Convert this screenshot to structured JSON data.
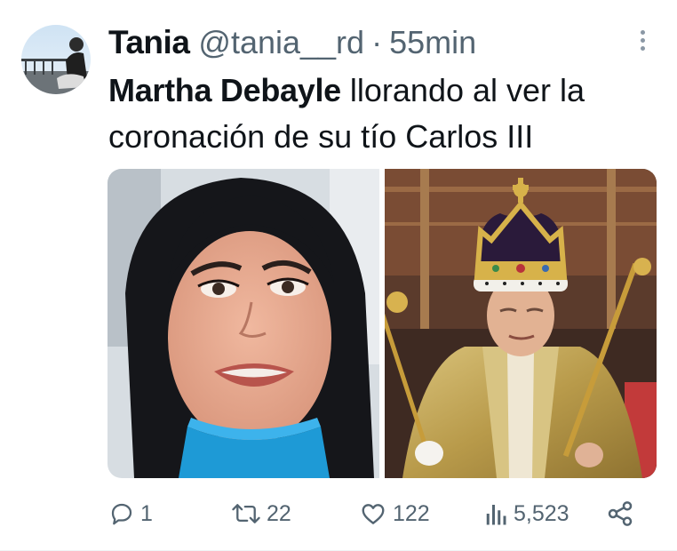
{
  "tweet": {
    "author": {
      "display_name": "Tania",
      "handle": "@tania__rd",
      "separator": "·",
      "time_ago": "55min"
    },
    "text": {
      "bold": "Martha Debayle",
      "rest": " llorando al ver la coronación de su tío Carlos III"
    },
    "media": [
      {
        "icon": "woman-crying-photo"
      },
      {
        "icon": "king-coronation-photo"
      }
    ],
    "actions": {
      "replies": "1",
      "retweets": "22",
      "likes": "122",
      "views": "5,523"
    }
  },
  "colors": {
    "secondary_text": "#536471",
    "primary_text": "#0f1419",
    "divider": "#eff3f4"
  }
}
